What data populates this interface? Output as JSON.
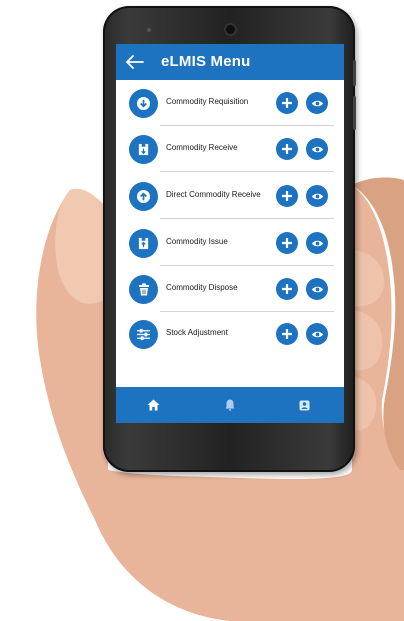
{
  "header": {
    "title": "eLMIS Menu"
  },
  "menu": {
    "items": [
      {
        "label": "Commodity Requisition",
        "icon": "arrow-down-circle-icon"
      },
      {
        "label": "Commodity Receive",
        "icon": "receive-box-icon"
      },
      {
        "label": "Direct Commodity Receive",
        "icon": "arrow-up-circle-icon"
      },
      {
        "label": "Commodity Issue",
        "icon": "issue-box-icon"
      },
      {
        "label": "Commodity Dispose",
        "icon": "trash-icon"
      },
      {
        "label": "Stock Adjustment",
        "icon": "sliders-icon"
      }
    ]
  },
  "bottom_nav": [
    "home-icon",
    "bell-icon",
    "profile-icon"
  ],
  "colors": {
    "primary": "#1e73c0",
    "background": "#ffffff",
    "phone_body": "#2a2a2a"
  }
}
